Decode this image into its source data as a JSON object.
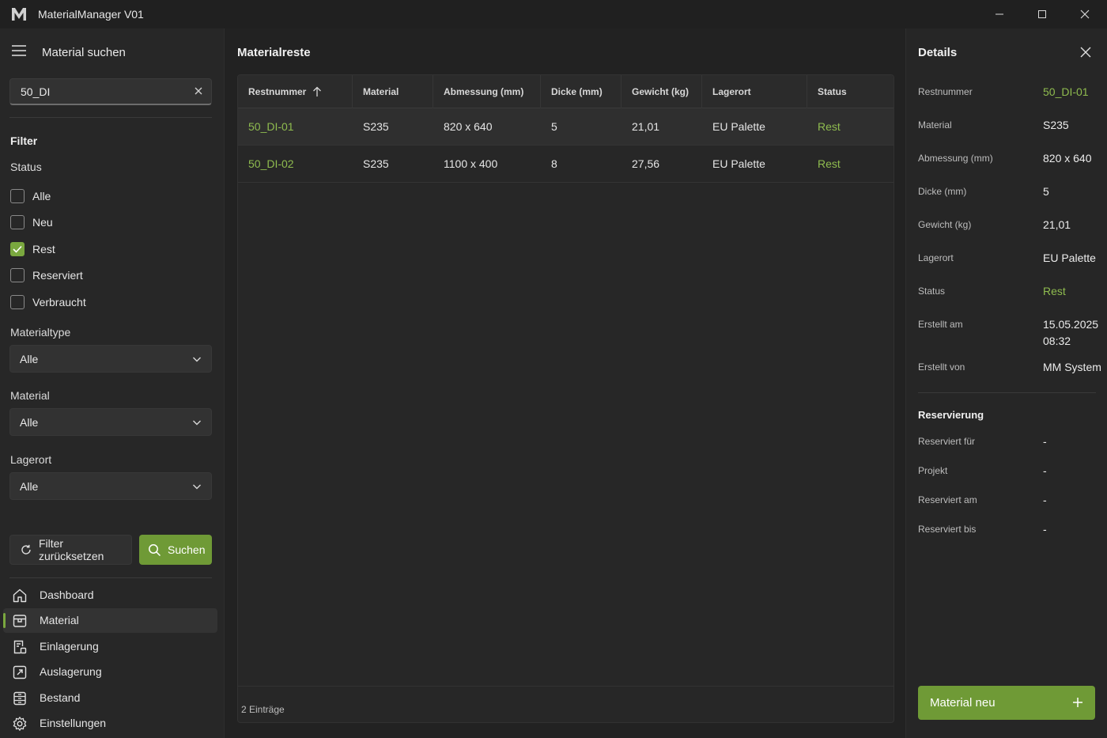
{
  "window": {
    "title": "MaterialManager V01",
    "logo_letter": "M"
  },
  "sidebar": {
    "title": "Material suchen",
    "search": {
      "value": "50_DI",
      "placeholder": ""
    },
    "filter_heading": "Filter",
    "status_label": "Status",
    "status_options": [
      {
        "label": "Alle",
        "checked": false
      },
      {
        "label": "Neu",
        "checked": false
      },
      {
        "label": "Rest",
        "checked": true
      },
      {
        "label": "Reserviert",
        "checked": false
      },
      {
        "label": "Verbraucht",
        "checked": false
      }
    ],
    "materialtype": {
      "label": "Materialtype",
      "value": "Alle"
    },
    "material": {
      "label": "Material",
      "value": "Alle"
    },
    "lagerort": {
      "label": "Lagerort",
      "value": "Alle"
    },
    "reset_label": "Filter zurücksetzen",
    "search_label": "Suchen",
    "nav": [
      {
        "label": "Dashboard",
        "icon": "home-icon",
        "active": false
      },
      {
        "label": "Material",
        "icon": "box-icon",
        "active": true
      },
      {
        "label": "Einlagerung",
        "icon": "store-in-icon",
        "active": false
      },
      {
        "label": "Auslagerung",
        "icon": "store-out-icon",
        "active": false
      },
      {
        "label": "Bestand",
        "icon": "inventory-icon",
        "active": false
      },
      {
        "label": "Einstellungen",
        "icon": "gear-icon",
        "active": false
      }
    ]
  },
  "main": {
    "title": "Materialreste",
    "columns": [
      "Restnummer",
      "Material",
      "Abmessung (mm)",
      "Dicke (mm)",
      "Gewicht (kg)",
      "Lagerort",
      "Status"
    ],
    "sort_column": "Restnummer",
    "sort_direction": "ascending",
    "rows": [
      [
        "50_DI-01",
        "S235",
        "820 x 640",
        "5",
        "21,01",
        "EU Palette",
        "Rest"
      ],
      [
        "50_DI-02",
        "S235",
        "1100 x 400",
        "8",
        "27,56",
        "EU Palette",
        "Rest"
      ]
    ],
    "footer": "2 Einträge"
  },
  "details": {
    "title": "Details",
    "fields": [
      {
        "key": "Restnummer",
        "value": "50_DI-01"
      },
      {
        "key": "Material",
        "value": "S235"
      },
      {
        "key": "Abmessung (mm)",
        "value": "820 x 640"
      },
      {
        "key": "Dicke (mm)",
        "value": "5"
      },
      {
        "key": "Gewicht (kg)",
        "value": "21,01"
      },
      {
        "key": "Lagerort",
        "value": "EU Palette"
      },
      {
        "key": "Status",
        "value": "Rest"
      },
      {
        "key": "Erstellt am",
        "value": "15.05.2025 08:32"
      },
      {
        "key": "Erstellt von",
        "value": "MM System"
      }
    ],
    "reservation_title": "Reservierung",
    "reservation_fields": [
      {
        "key": "Reserviert für",
        "value": "-"
      },
      {
        "key": "Projekt",
        "value": "-"
      },
      {
        "key": "Reserviert am",
        "value": "-"
      },
      {
        "key": "Reserviert bis",
        "value": "-"
      }
    ],
    "new_button_label": "Material neu"
  },
  "colors": {
    "accent": "#6f9a36",
    "accent_text": "#8fbc4f",
    "background": "#202020"
  }
}
